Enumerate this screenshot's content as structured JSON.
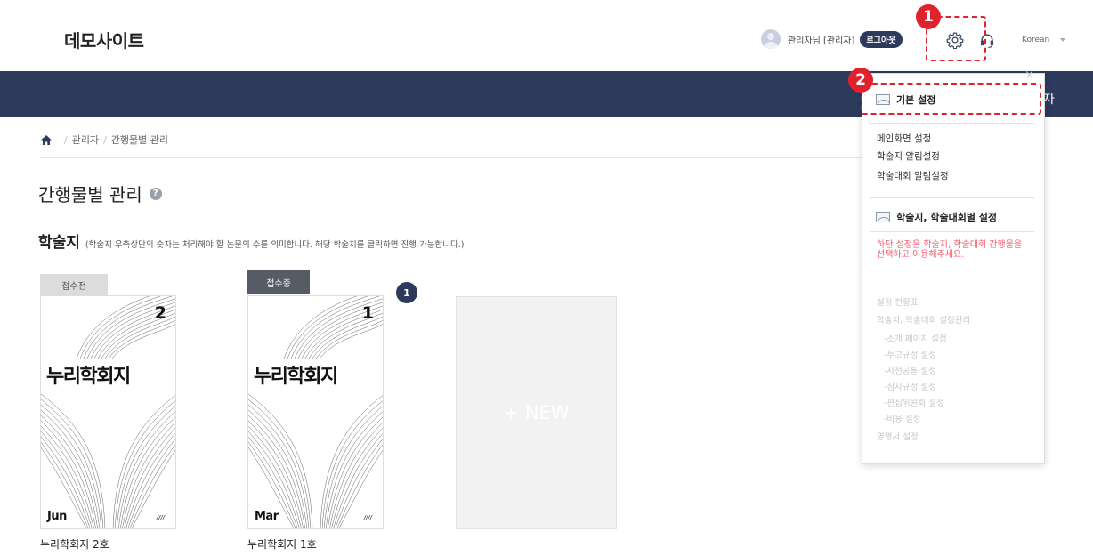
{
  "header": {
    "site_title": "데모사이트",
    "username": "관리자님 [관리자]",
    "logout_label": "로그아웃",
    "language": "Korean"
  },
  "callouts": [
    "1",
    "2"
  ],
  "navbar": {
    "visible_text": "자"
  },
  "breadcrumb": [
    "관리자",
    "간행물별 관리"
  ],
  "page": {
    "title": "간행물별 관리",
    "help_icon": "?",
    "section_title": "학술지",
    "section_note": "(학술지 우측상단의 숫자는 처리해야 할 논문의 수를 의미합니다. 해당 학술지를 클릭하면 진행 가능합니다.)"
  },
  "journals": [
    {
      "status": "접수전",
      "cover_number": "2",
      "cover_title": "누리학회지",
      "cover_month": "Jun",
      "cover_mark": "////",
      "label": "누리학회지 2호",
      "pending_count": ""
    },
    {
      "status": "접수중",
      "cover_number": "1",
      "cover_title": "누리학회지",
      "cover_month": "Mar",
      "cover_mark": "////",
      "label": "누리학회지 1호",
      "pending_count": "1"
    }
  ],
  "new_card_label": "+ NEW",
  "dropdown": {
    "close": "×",
    "basic_settings": "기본 설정",
    "basic_items": [
      "메인화면 설정",
      "학술지 알림설정",
      "학술대회 알림설정"
    ],
    "journal_settings": "학술지, 학술대회별 설정",
    "warning": "하단 설정은 학술지, 학술대회 간행물을 선택하고 이용해주세요.",
    "disabled_items": [
      "설정 현황표",
      "학술지, 학술대회 설정관리",
      "-소개 페이지 설정",
      "-투고규정 설정",
      "-사전공통 설정",
      "-심사규정 설정",
      "-편집위원회 설정",
      "-비용 설정",
      "영명서 설정"
    ]
  },
  "colors": {
    "navy": "#2d3a5c",
    "callout_red": "#e0222c",
    "warning_pink": "#f25b6f"
  },
  "icons": [
    "home-icon",
    "help-icon",
    "gear-icon",
    "headset-icon",
    "settings-image-icon",
    "close-icon",
    "chevron-down-icon"
  ]
}
